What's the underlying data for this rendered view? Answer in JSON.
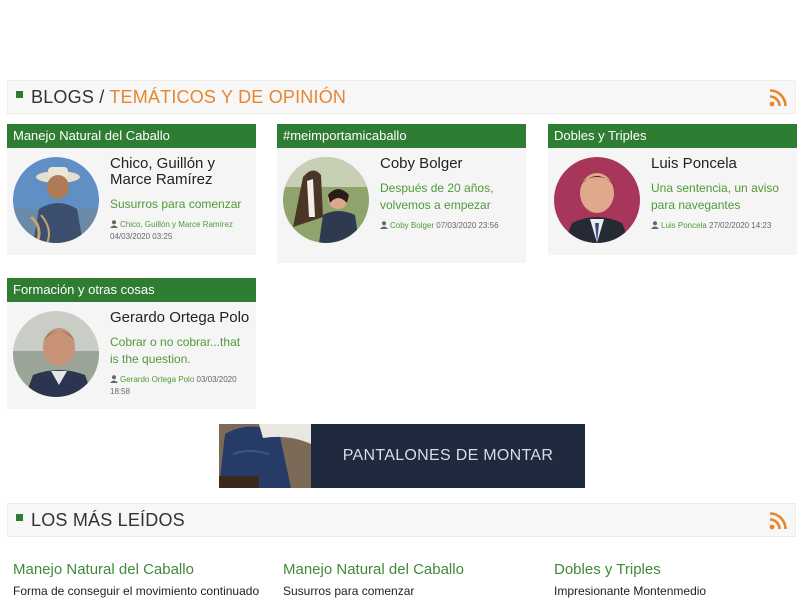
{
  "blogs_header": {
    "title_main": "BLOGS",
    "separator": "/",
    "title_accent": "TEMÁTICOS Y DE OPINIÓN"
  },
  "cards": [
    {
      "category": "Manejo Natural del Caballo",
      "name": "Chico, Guillón y Marce Ramírez",
      "post": "Susurros para comenzar",
      "meta_author": "Chico, Guillón y Marce Ramírez",
      "meta_date": "04/03/2020 03:25"
    },
    {
      "category": "#meimportamicaballo",
      "name": "Coby Bolger",
      "post": "Después de 20 años, volvemos a empezar",
      "meta_author": "Coby Bolger",
      "meta_date": "07/03/2020 23:56"
    },
    {
      "category": "Dobles y Triples",
      "name": "Luis Poncela",
      "post": "Una sentencia, un aviso para navegantes",
      "meta_author": "Luis Poncela",
      "meta_date": "27/02/2020 14:23"
    },
    {
      "category": "Formación y otras cosas",
      "name": "Gerardo Ortega Polo",
      "post": "Cobrar o no cobrar...that is the question.",
      "meta_author": "Gerardo Ortega Polo",
      "meta_date": "03/03/2020 18:58"
    }
  ],
  "banner": {
    "text": "PANTALONES DE MONTAR"
  },
  "most_read_header": {
    "title": "LOS MÁS LEÍDOS"
  },
  "most_read": [
    {
      "category": "Manejo Natural del Caballo",
      "title": "Forma de conseguir el movimiento continuado"
    },
    {
      "category": "Manejo Natural del Caballo",
      "title": "Susurros para comenzar"
    },
    {
      "category": "Dobles y Triples",
      "title": "Impresionante Montenmedio"
    }
  ],
  "colors": {
    "brand_green": "#2f7d32",
    "accent_orange": "#e8862e",
    "link_green": "#4f9a3a"
  },
  "icons": {
    "rss": "rss-icon",
    "user": "user-icon"
  }
}
